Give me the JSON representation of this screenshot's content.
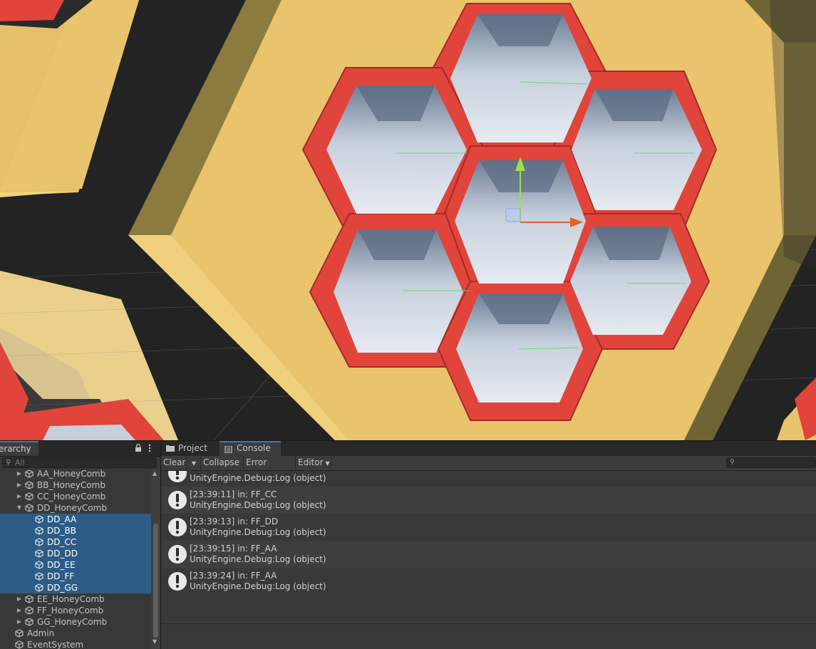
{
  "hierarchy": {
    "tab_label": "erarchy",
    "search_placeholder": "All",
    "items": [
      {
        "label": "AA_HoneyComb",
        "expand": "collapsed",
        "depth": 1,
        "selected": false
      },
      {
        "label": "BB_HoneyComb",
        "expand": "collapsed",
        "depth": 1,
        "selected": false
      },
      {
        "label": "CC_HoneyComb",
        "expand": "collapsed",
        "depth": 1,
        "selected": false
      },
      {
        "label": "DD_HoneyComb",
        "expand": "expanded",
        "depth": 1,
        "selected": false
      },
      {
        "label": "DD_AA",
        "expand": "none",
        "depth": 2,
        "selected": true
      },
      {
        "label": "DD_BB",
        "expand": "none",
        "depth": 2,
        "selected": true
      },
      {
        "label": "DD_CC",
        "expand": "none",
        "depth": 2,
        "selected": true
      },
      {
        "label": "DD_DD",
        "expand": "none",
        "depth": 2,
        "selected": true
      },
      {
        "label": "DD_EE",
        "expand": "none",
        "depth": 2,
        "selected": true
      },
      {
        "label": "DD_FF",
        "expand": "none",
        "depth": 2,
        "selected": true
      },
      {
        "label": "DD_GG",
        "expand": "none",
        "depth": 2,
        "selected": true
      },
      {
        "label": "EE_HoneyComb",
        "expand": "collapsed",
        "depth": 1,
        "selected": false
      },
      {
        "label": "FF_HoneyComb",
        "expand": "collapsed",
        "depth": 1,
        "selected": false
      },
      {
        "label": "GG_HoneyComb",
        "expand": "collapsed",
        "depth": 1,
        "selected": false
      },
      {
        "label": "Admin",
        "expand": "none",
        "depth": 0,
        "selected": false
      },
      {
        "label": "EventSystem",
        "expand": "none",
        "depth": 0,
        "selected": false
      }
    ]
  },
  "console": {
    "tabs": {
      "project": "Project",
      "console": "Console"
    },
    "toolbar": {
      "clear": "Clear",
      "collapse": "Collapse",
      "error_pause": "Error Pause",
      "editor": "Editor"
    },
    "messages": [
      {
        "line1": "",
        "line2": "UnityEngine.Debug:Log (object)"
      },
      {
        "line1": "[23:39:11] in: FF_CC",
        "line2": "UnityEngine.Debug:Log (object)"
      },
      {
        "line1": "[23:39:13] in: FF_DD",
        "line2": "UnityEngine.Debug:Log (object)"
      },
      {
        "line1": "[23:39:15] in: FF_AA",
        "line2": "UnityEngine.Debug:Log (object)"
      },
      {
        "line1": "[23:39:24] in: FF_AA",
        "line2": "UnityEngine.Debug:Log (object)"
      }
    ]
  },
  "colors": {
    "selection": "#2c5d87",
    "honeycomb_red": "#e0443a",
    "board_yellow": "#e9c46c",
    "panel_bg": "#383838"
  },
  "icons": {
    "hierarchy_item": "gameobject-cube-icon",
    "console_message": "info-exclamation-icon",
    "lock": "lock-icon",
    "menu": "kebab-menu-icon"
  }
}
